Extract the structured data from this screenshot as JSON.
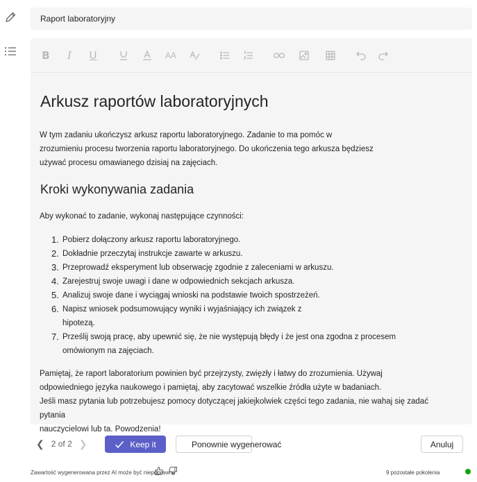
{
  "title_field": {
    "value": "Raport laboratoryjny"
  },
  "toolbar": {
    "buttons": [
      "bold-icon",
      "italic-icon",
      "underline-icon",
      "highlight-icon",
      "font-color-icon",
      "font-size-icon",
      "format-styles-icon",
      "bullet-list-icon",
      "numbered-list-icon",
      "link-icon",
      "image-icon",
      "table-icon",
      "undo-icon",
      "redo-icon"
    ]
  },
  "document": {
    "title": "Arkusz raportów laboratoryjnych",
    "intro_lines": [
      "W tym zadaniu ukończysz arkusz raportu laboratoryjnego. Zadanie to ma pomóc w",
      "zrozumieniu procesu tworzenia raportu laboratoryjnego. Do ukończenia tego arkusza będziesz",
      "używać procesu omawianego dzisiaj na zajęciach."
    ],
    "subtitle": "Kroki wykonywania zadania",
    "lead": "Aby wykonać to zadanie, wykonaj następujące czynności:",
    "steps": [
      {
        "num": "1.",
        "text": "Pobierz dołączony arkusz raportu laboratoryjnego."
      },
      {
        "num": "2.",
        "text": "Dokładnie przeczytaj instrukcje zawarte w arkuszu."
      },
      {
        "num": "3.",
        "text": "Przeprowadź eksperyment lub obserwację zgodnie z zaleceniami w arkuszu."
      },
      {
        "num": "4.",
        "text": "Zarejestruj swoje uwagi i dane w odpowiednich sekcjach arkusza."
      },
      {
        "num": "5.",
        "text": "Analizuj swoje dane i wyciągaj wnioski na podstawie twoich spostrzeżeń."
      },
      {
        "num": "6.",
        "text": "Napisz wniosek podsumowujący wyniki i wyjaśniający ich związek z hipotezą."
      },
      {
        "num": "7.",
        "text": "Prześlij swoją pracę, aby upewnić się, że nie występują błędy i że jest ona zgodna z procesem omówionym na zajęciach."
      }
    ],
    "outro_lines": [
      "Pamiętaj, że raport laboratorium powinien być przejrzysty, zwięzły i łatwy do zrozumienia. Używaj",
      "odpowiedniego języka naukowego i pamiętaj, aby zacytować wszelkie źródła użyte w badaniach.",
      "Jeśli masz pytania lub potrzebujesz pomocy dotyczącej jakiejkolwiek części tego zadania, nie wahaj się zadać pytania",
      "nauczycielowi lub ta. Powodzenia!"
    ]
  },
  "footer": {
    "pager": "2 of 2",
    "keep_label": "Keep it",
    "regenerate_label": "Ponownie wygenerować",
    "cancel_label": "Anuluj",
    "ai_note": "Zawartość wygenerowana przez AI może być niepoprawna",
    "generations_left": "9 pozostałe pokolenia",
    "status_color": "#13a10e",
    "accent_color": "#5b5fc7"
  }
}
